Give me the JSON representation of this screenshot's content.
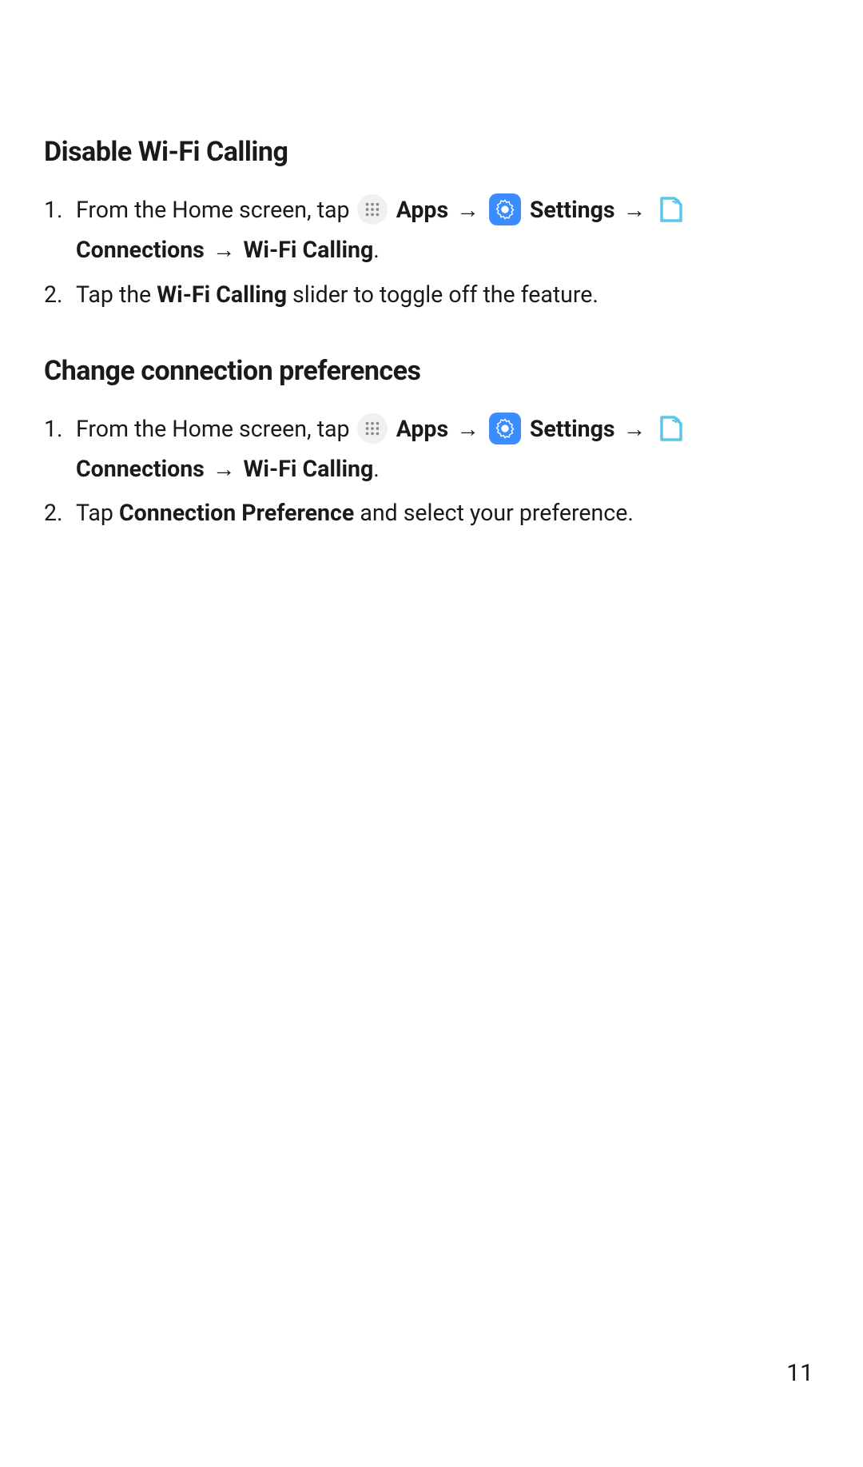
{
  "section1": {
    "heading": "Disable Wi-Fi Calling",
    "step1": {
      "text_before_apps": "From the Home screen, tap ",
      "apps_label": "Apps",
      "arrow": " → ",
      "settings_label": "Settings",
      "connections_label": "Connections",
      "wifi_calling_label": "Wi-Fi Calling",
      "period": "."
    },
    "step2": {
      "part1": "Tap the ",
      "bold1": "Wi-Fi Calling",
      "part2": " slider to toggle off the feature."
    }
  },
  "section2": {
    "heading": "Change connection preferences",
    "step1": {
      "text_before_apps": "From the Home screen, tap ",
      "apps_label": "Apps",
      "arrow": " → ",
      "settings_label": "Settings",
      "connections_label": "Connections",
      "wifi_calling_label": "Wi-Fi Calling",
      "period": "."
    },
    "step2": {
      "part1": "Tap ",
      "bold1": "Connection Preference",
      "part2": " and select your preference."
    }
  },
  "page_number": "11"
}
